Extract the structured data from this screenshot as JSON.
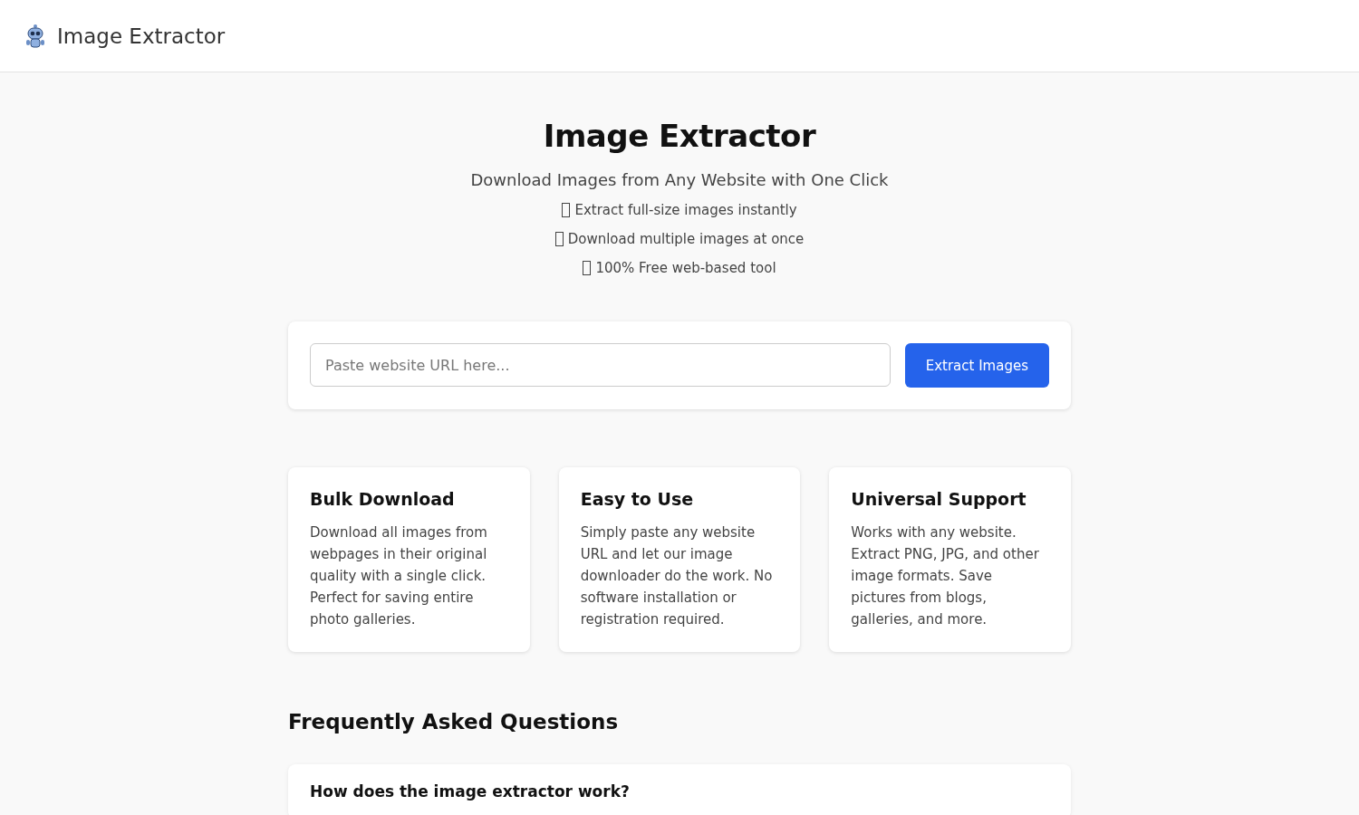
{
  "header": {
    "title": "Image Extractor"
  },
  "hero": {
    "title": "Image Extractor",
    "subtitle": "Download Images from Any Website with One Click",
    "features": [
      "Extract full-size images instantly",
      "Download multiple images at once",
      "100% Free web-based tool"
    ]
  },
  "search": {
    "placeholder": "Paste website URL here...",
    "button": "Extract Images"
  },
  "cards": [
    {
      "title": "Bulk Download",
      "text": "Download all images from webpages in their original quality with a single click. Perfect for saving entire photo galleries."
    },
    {
      "title": "Easy to Use",
      "text": "Simply paste any website URL and let our image downloader do the work. No software installation or registration required."
    },
    {
      "title": "Universal Support",
      "text": "Works with any website. Extract PNG, JPG, and other image formats. Save pictures from blogs, galleries, and more."
    }
  ],
  "faq": {
    "title": "Frequently Asked Questions",
    "questions": [
      "How does the image extractor work?"
    ]
  }
}
